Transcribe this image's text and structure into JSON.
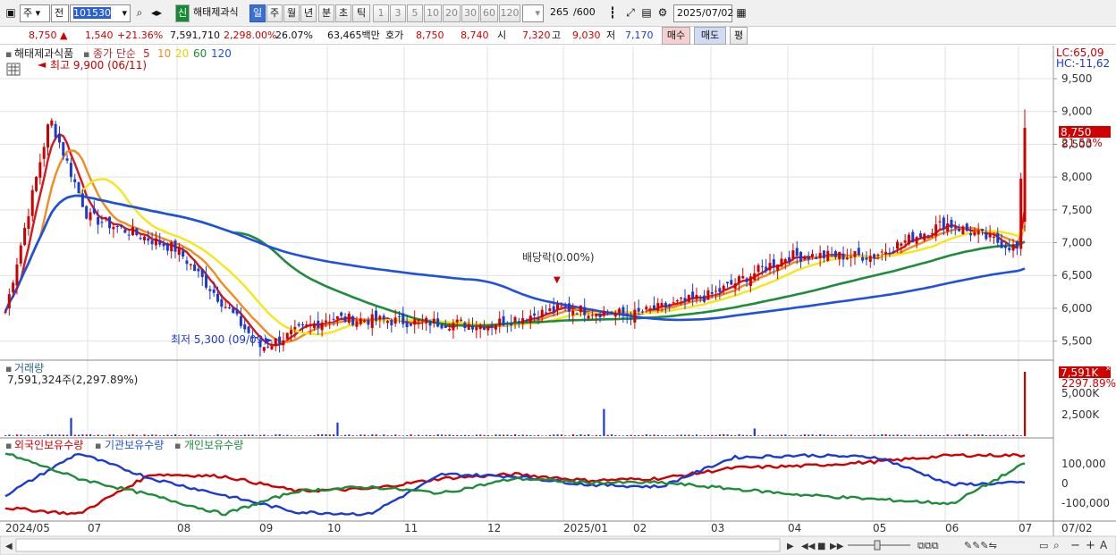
{
  "toolbar": {
    "market": "주",
    "prev": "전",
    "code": "101530",
    "new_badge": "신",
    "stock_name": "해태제과식",
    "periods": [
      "일",
      "주",
      "월",
      "년",
      "분",
      "초",
      "틱"
    ],
    "active_period": "일",
    "intervals": [
      "1",
      "3",
      "5",
      "10",
      "20",
      "30",
      "60",
      "120"
    ],
    "count": "265",
    "max": "/600",
    "date": "2025/07/02"
  },
  "quote": {
    "price": "8,750",
    "change": "1,540",
    "rate": "+21.36%",
    "volume": "7,591,710",
    "vol_ratio": "2,298.00%",
    "turnover": "26.07%",
    "amount": "63,465백만",
    "hoga_label": "호가",
    "ask": "8,750",
    "bid": "8,740",
    "open_label": "시",
    "open": "7,320",
    "high_label": "고",
    "high": "9,030",
    "low_label": "저",
    "low": "7,170",
    "buy": "매수",
    "sell": "매도",
    "eval": "평"
  },
  "price_panel": {
    "name": "해태제과식품",
    "ma_label": "종가 단순",
    "ma_periods": [
      "5",
      "10",
      "20",
      "60",
      "120"
    ],
    "high_note": "최고 9,900 (06/11)",
    "low_note": "최저 5,300 (09/09)",
    "dividend_note": "배당락(0.00%)",
    "lc": "LC:65,09",
    "hc": "HC:-11,62",
    "last_price": "8,750",
    "last_rate": "21.53%"
  },
  "volume_panel": {
    "title": "거래량",
    "value": "7,591,324주(2,297.89%)",
    "last": "7,591K",
    "last_rate": "2297.89%",
    "axis": [
      "5,000K",
      "2,500K"
    ]
  },
  "holdings_panel": {
    "legend": [
      "외국인보유수량",
      "기관보유수량",
      "개인보유수량"
    ],
    "axis": [
      "100,000",
      "0",
      "-100,000"
    ]
  },
  "x_axis": [
    "2024/05",
    "07",
    "08",
    "09",
    "10",
    "11",
    "12",
    "2025/01",
    "02",
    "03",
    "04",
    "05",
    "06",
    "07",
    "07/02"
  ],
  "y_axis": [
    "9,500",
    "9,000",
    "8,500",
    "8,000",
    "7,500",
    "7,000",
    "6,500",
    "6,000",
    "5,500"
  ],
  "colors": {
    "up": "#d00000",
    "down": "#1a3ad0",
    "ma5": "#d81818",
    "ma10": "#f08c1e",
    "ma20": "#f5e61a",
    "ma60": "#1e8c3a",
    "ma120": "#2050e0"
  },
  "chart_data": {
    "type": "candlestick",
    "price_range": [
      5250,
      9950
    ],
    "volume_max": 7591,
    "holdings_range": [
      -170000,
      170000
    ],
    "anchors": [
      {
        "date": "2024/05",
        "close": 5950
      },
      {
        "date": "2024/06/11",
        "close": 8900
      },
      {
        "date": "2024/07",
        "close": 7400
      },
      {
        "date": "2024/08",
        "close": 6900
      },
      {
        "date": "2024/09/09",
        "close": 5400
      },
      {
        "date": "2024/10",
        "close": 5850
      },
      {
        "date": "2024/11",
        "close": 5800
      },
      {
        "date": "2024/12",
        "close": 5750
      },
      {
        "date": "2025/01",
        "close": 6000
      },
      {
        "date": "2025/02",
        "close": 5900
      },
      {
        "date": "2025/03",
        "close": 6200
      },
      {
        "date": "2025/04",
        "close": 6800
      },
      {
        "date": "2025/05",
        "close": 6800
      },
      {
        "date": "2025/06",
        "close": 7300
      },
      {
        "date": "2025/07",
        "close": 6900
      },
      {
        "date": "2025/07/02",
        "close": 8750
      }
    ],
    "last": {
      "open": 7320,
      "high": 9030,
      "low": 7170,
      "close": 8750,
      "volume": 7591
    }
  }
}
